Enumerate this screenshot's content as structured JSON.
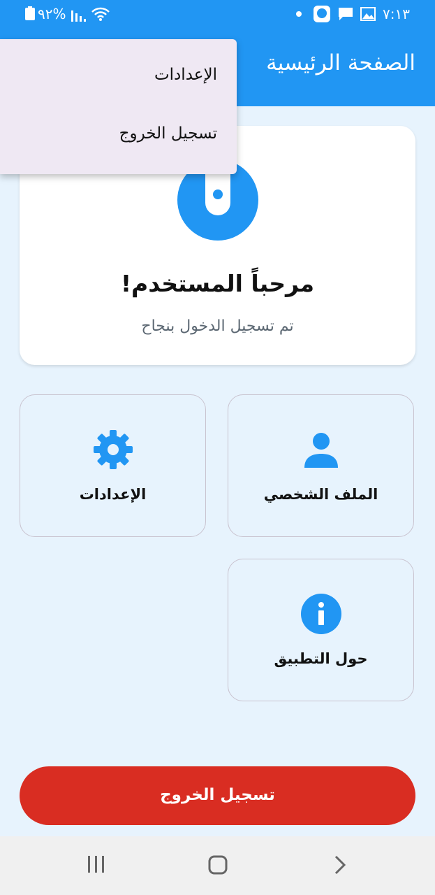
{
  "status_bar": {
    "time": "٧:١٣",
    "battery_text": "٩٢%"
  },
  "app_bar": {
    "title": "الصفحة الرئيسية"
  },
  "welcome_card": {
    "title": "مرحباً المستخدم!",
    "subtitle": "تم تسجيل الدخول بنجاح"
  },
  "tiles": {
    "profile": {
      "label": "الملف الشخصي",
      "icon": "person-icon"
    },
    "settings": {
      "label": "الإعدادات",
      "icon": "gear-icon"
    },
    "about": {
      "label": "حول التطبيق",
      "icon": "info-icon"
    }
  },
  "logout_button": {
    "label": "تسجيل الخروج"
  },
  "overflow_menu": {
    "items": [
      {
        "label": "الإعدادات"
      },
      {
        "label": "تسجيل الخروج"
      }
    ]
  },
  "colors": {
    "primary": "#2196f3",
    "background": "#e7f3fd",
    "danger": "#d92d22",
    "menu_bg": "#efe8f3"
  }
}
